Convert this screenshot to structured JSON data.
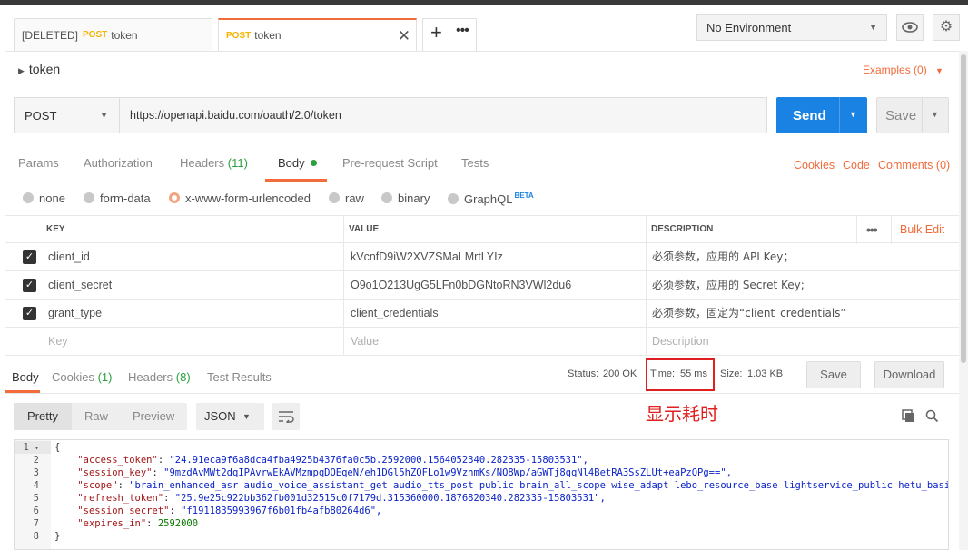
{
  "tabs": [
    {
      "prefix": "[DELETED]",
      "method": "POST",
      "name": "token"
    },
    {
      "prefix": "",
      "method": "POST",
      "name": "token"
    }
  ],
  "environment": {
    "selected": "No Environment"
  },
  "request": {
    "title": "token",
    "examples": "Examples (0)",
    "method": "POST",
    "url": "https://openapi.baidu.com/oauth/2.0/token",
    "send_label": "Send",
    "save_label": "Save"
  },
  "request_tabs": {
    "params": "Params",
    "authorization": "Authorization",
    "headers": "Headers",
    "headers_count": "(11)",
    "body": "Body",
    "prerequest": "Pre-request Script",
    "tests": "Tests",
    "cookies": "Cookies",
    "code": "Code",
    "comments": "Comments (0)"
  },
  "body_types": {
    "none": "none",
    "form_data": "form-data",
    "urlencoded": "x-www-form-urlencoded",
    "raw": "raw",
    "binary": "binary",
    "graphql": "GraphQL",
    "beta": "BETA",
    "selected": "x-www-form-urlencoded"
  },
  "table": {
    "headers": {
      "key": "KEY",
      "value": "VALUE",
      "description": "DESCRIPTION",
      "bulk_edit": "Bulk Edit"
    },
    "rows": [
      {
        "key": "client_id",
        "value": "kVcnfD9iW2XVZSMaLMrtLYIz",
        "description": "必须参数，应用的 API Key；",
        "checked": true
      },
      {
        "key": "client_secret",
        "value": "O9o1O213UgG5LFn0bDGNtoRN3VWl2du6",
        "description": "必须参数，应用的 Secret Key;",
        "checked": true
      },
      {
        "key": "grant_type",
        "value": "client_credentials",
        "description": "必须参数，固定为“client_credentials”",
        "checked": true
      }
    ],
    "placeholders": {
      "key": "Key",
      "value": "Value",
      "description": "Description"
    }
  },
  "response": {
    "tabs": {
      "body": "Body",
      "cookies": "Cookies",
      "cookies_count": "(1)",
      "headers": "Headers",
      "headers_count": "(8)",
      "tests": "Test Results"
    },
    "status_label": "Status:",
    "status_value": "200 OK",
    "time_label": "Time:",
    "time_value": "55 ms",
    "size_label": "Size:",
    "size_value": "1.03 KB",
    "save_label": "Save",
    "download_label": "Download",
    "view_modes": {
      "pretty": "Pretty",
      "raw": "Raw",
      "preview": "Preview"
    },
    "format": "JSON",
    "annotation": "显示耗时",
    "code_lines": [
      {
        "num": "1",
        "text": "{"
      },
      {
        "num": "2",
        "key": "\"access_token\"",
        "value": "\"24.91eca9f6a8dca4fba4925b4376fa0c5b.2592000.1564052340.282335-15803531\","
      },
      {
        "num": "3",
        "key": "\"session_key\"",
        "value": "\"9mzdAvMWt2dqIPAvrwEkAVMzmpqDOEqeN/eh1DGl5hZQFLo1w9VznmKs/NQ8Wp/aGWTj8qqNl4BetRA3SsZLUt+eaPzQPg==\","
      },
      {
        "num": "4",
        "key": "\"scope\"",
        "value": "\"brain_enhanced_asr audio_voice_assistant_get audio_tts_post public brain_all_scope wise_adapt lebo_resource_base lightservice_public hetu_basic"
      },
      {
        "num": "5",
        "key": "\"refresh_token\"",
        "value": "\"25.9e25c922bb362fb001d32515c0f7179d.315360000.1876820340.282335-15803531\","
      },
      {
        "num": "6",
        "key": "\"session_secret\"",
        "value": "\"f1911835993967f6b01fb4afb80264d6\","
      },
      {
        "num": "7",
        "key": "\"expires_in\"",
        "value": "2592000"
      },
      {
        "num": "8",
        "text": "}"
      }
    ]
  },
  "colors": {
    "accent": "#f26b3a",
    "send": "#1a82e2",
    "ok": "#2aa03f",
    "annotation": "#e02020"
  }
}
